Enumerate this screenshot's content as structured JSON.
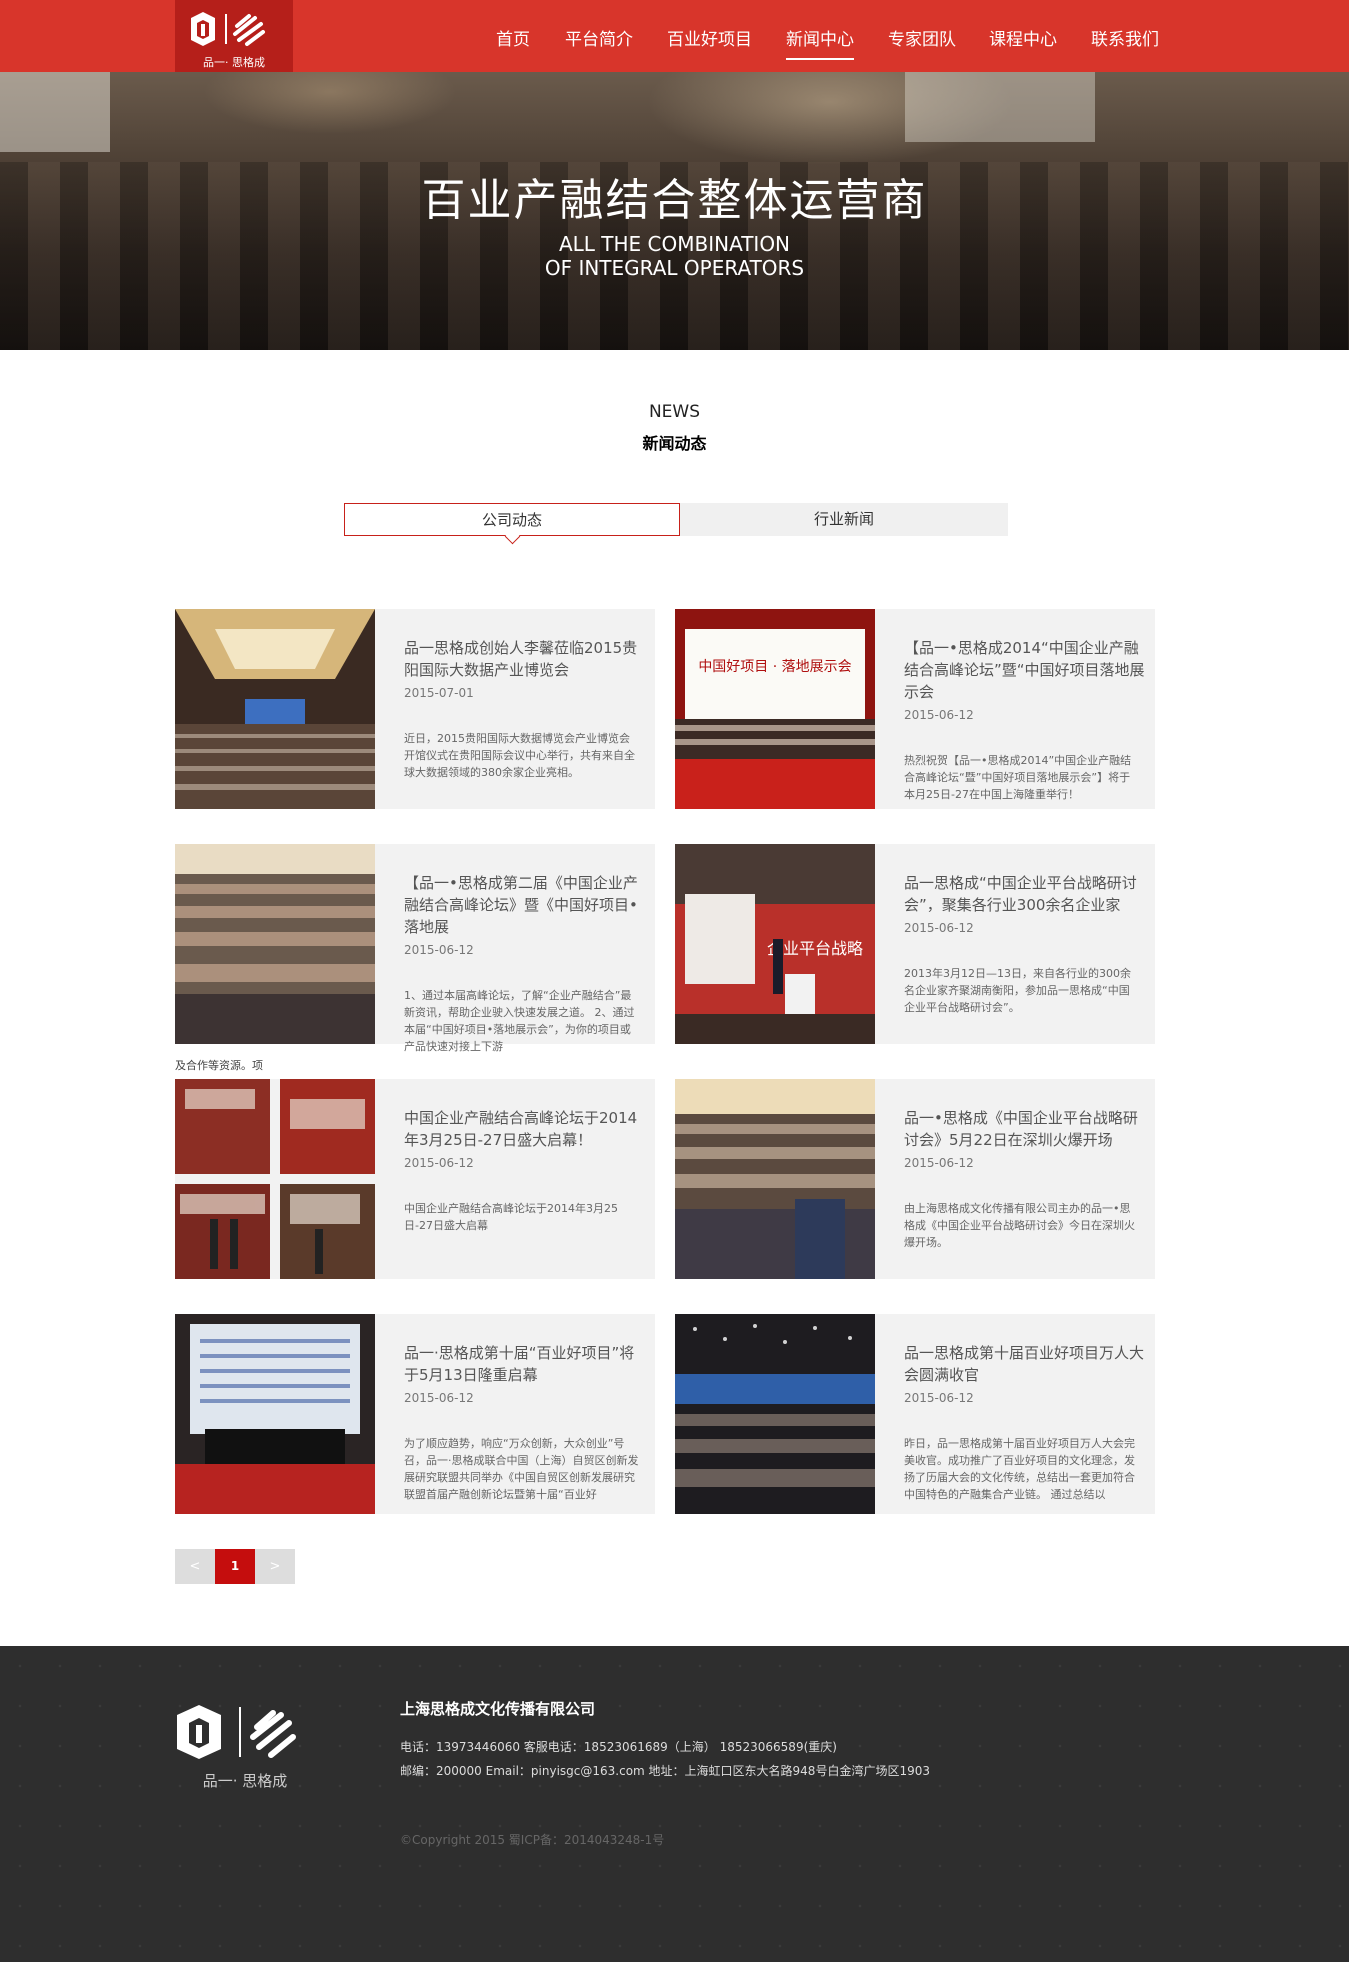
{
  "header": {
    "logo_caption": "品一· 思格成",
    "nav": [
      "首页",
      "平台简介",
      "百业好项目",
      "新闻中心",
      "专家团队",
      "课程中心",
      "联系我们"
    ]
  },
  "banner": {
    "title": "百业产融结合整体运营商",
    "en_line1": "ALL THE COMBINATION",
    "en_line2": "OF INTEGRAL OPERATORS"
  },
  "section": {
    "en": "NEWS",
    "cn": "新闻动态"
  },
  "tabs": [
    "公司动态",
    "行业新闻"
  ],
  "news": [
    {
      "title": "品一思格成创始人李馨莅临2015贵阳国际大数据产业博览会",
      "date": "2015-07-01",
      "summary": "近日，2015贵阳国际大数据博览会产业博览会开馆仪式在贵阳国际会议中心举行，共有来自全球大数据领域的380余家企业亮相。"
    },
    {
      "title": "【品一•思格成2014“中国企业产融结合高峰论坛”暨“中国好项目落地展示会",
      "date": "2015-06-12",
      "summary": "热烈祝贺【品一•思格成2014”中国企业产融结合高峰论坛“暨”中国好项目落地展示会”】将于本月25日-27在中国上海隆重举行！",
      "img_text": "中国好项目 · 落地展示会"
    },
    {
      "title": "【品一•思格成第二届《中国企业产融结合高峰论坛》暨《中国好项目•落地展",
      "date": "2015-06-12",
      "summary": "1、通过本届高峰论坛，了解“企业产融结合”最新资讯，帮助企业驶入快速发展之道。 2、通过本届“中国好项目•落地展示会”，为你的项目或产品快速对接上下游",
      "overflow": "及合作等资源。项"
    },
    {
      "title": "品一思格成“中国企业平台战略研讨会”，聚集各行业300余名企业家",
      "date": "2015-06-12",
      "summary": "2013年3月12日—13日，来自各行业的300余名企业家齐聚湖南衡阳，参加品一思格成“中国企业平台战略研讨会”。",
      "img_text": "企业平台战略"
    },
    {
      "title": "中国企业产融结合高峰论坛于2014年3月25日-27日盛大启幕！",
      "date": "2015-06-12",
      "summary": "中国企业产融结合高峰论坛于2014年3月25日-27日盛大启幕"
    },
    {
      "title": "品一•思格成《中国企业平台战略研讨会》5月22日在深圳火爆开场",
      "date": "2015-06-12",
      "summary": "由上海思格成文化传播有限公司主办的品一•思格成《中国企业平台战略研讨会》今日在深圳火爆开场。"
    },
    {
      "title": "品一·思格成第十届“百业好项目”将于5月13日隆重启幕",
      "date": "2015-06-12",
      "summary": "为了顺应趋势，响应“万众创新，大众创业”号召，品一·思格成联合中国（上海）自贸区创新发展研究联盟共同举办《中国自贸区创新发展研究联盟首届产融创新论坛暨第十届“百业好"
    },
    {
      "title": "品一思格成第十届百业好项目万人大会圆满收官",
      "date": "2015-06-12",
      "summary": "昨日，品一思格成第十届百业好项目万人大会完美收官。成功推广了百业好项目的文化理念，发扬了历届大会的文化传统，总结出一套更加符合中国特色的产融集合产业链。 通过总结以"
    }
  ],
  "pagination": {
    "prev": "<",
    "current": "1",
    "next": ">"
  },
  "footer": {
    "logo_caption": "品一· 思格成",
    "company": "上海思格成文化传播有限公司",
    "line1": "电话：13973446060    客服电话：18523061689（上海）  18523066589(重庆)",
    "line2": "邮编：200000   Email：pinyisgc@163.com    地址：上海虹口区东大名路948号白金湾广场区1903",
    "copyright": "©Copyright 2015 蜀ICP备：2014043248-1号"
  }
}
